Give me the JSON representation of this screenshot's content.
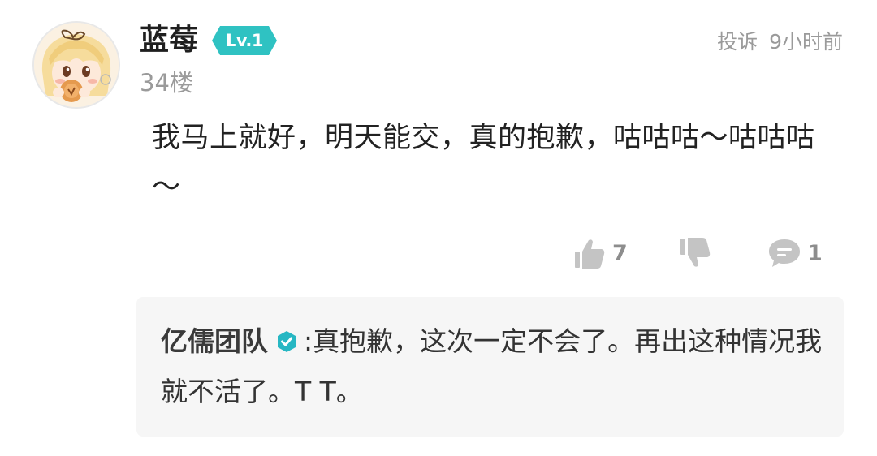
{
  "comment": {
    "username": "蓝莓",
    "level": "Lv.1",
    "floor": "34楼",
    "report_label": "投诉",
    "time": "9小时前",
    "body": "我马上就好，明天能交，真的抱歉，咕咕咕～咕咕咕～",
    "likes": "7",
    "replies_count": "1"
  },
  "reply": {
    "author": "亿儒团队",
    "separator": ":",
    "text": "真抱歉，这次一定不会了。再出这种情况我就不活了。T T。"
  },
  "colors": {
    "level_badge": "#2fc2c2",
    "verified_badge": "#27b7c3",
    "icon_gray": "#c4c4c4",
    "reply_bg": "#f6f6f6",
    "meta_gray": "#9a9a9a"
  },
  "icons": {
    "like": "thumbs-up-icon",
    "dislike": "thumbs-down-icon",
    "comment": "speech-bubble-icon",
    "verified": "verified-check-icon"
  }
}
